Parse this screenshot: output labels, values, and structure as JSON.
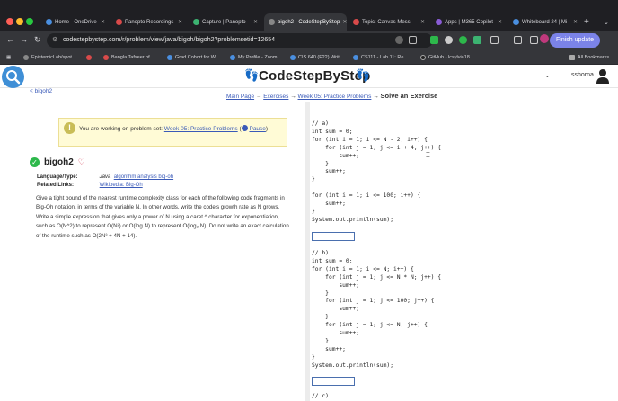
{
  "browser": {
    "tabs": [
      {
        "label": "Home - OneDrive",
        "color": "#4a8fe0"
      },
      {
        "label": "Panopto Recordings",
        "color": "#d94a4a"
      },
      {
        "label": "Capture | Panopto",
        "color": "#3cb371"
      },
      {
        "label": "bigoh2 - CodeStepByStep",
        "color": "#888888",
        "active": true
      },
      {
        "label": "Topic: Canvas Mess",
        "color": "#d94a4a"
      },
      {
        "label": "Apps | M365 Copilot",
        "color": "#8a5cd6"
      },
      {
        "label": "Whiteboard 24 | Mi",
        "color": "#4a8fe0"
      }
    ],
    "url": "codestepbystep.com/r/problem/view/java/bigoh/bigoh2?problemsetid=12654",
    "finish_update": "Finish update",
    "bookmarks": [
      {
        "label": "EpistemicLab/spot...",
        "color": "#888888"
      },
      {
        "label": "Bangla Tafseer of...",
        "color": "#d94a4a"
      },
      {
        "label": "Grad Cohort for W...",
        "color": "#4a8fe0"
      },
      {
        "label": "My Profile - Zoom",
        "color": "#4a8fe0"
      },
      {
        "label": "CIS 640 (F22) Writ...",
        "color": "#4a8fe0"
      },
      {
        "label": "CS111 - Lab 11: Re...",
        "color": "#4a8fe0"
      },
      {
        "label": "GitHub - lcsylvia18...",
        "color": "#222222"
      },
      {
        "label": "All Bookmarks",
        "color": "#aaaaaa"
      }
    ]
  },
  "site": {
    "title": "CodeStepByStep",
    "user": "sshorna",
    "back_link": "< bigoh2"
  },
  "breadcrumb": {
    "main": "Main Page",
    "exercises": "Exercises",
    "week": "Week 05: Practice Problems",
    "current": "Solve an Exercise",
    "sep": "→"
  },
  "notice": {
    "prefix": "You are working on problem set:",
    "set_link": "Week 05: Practice Problems",
    "pause": "Pause"
  },
  "problem": {
    "name": "bigoh2",
    "language_label": "Language/Type:",
    "language": "Java",
    "tags": "algorithm analysis big-oh",
    "related_label": "Related Links:",
    "related": "Wikipedia: Big-Oh",
    "description": "Give a tight bound of the nearest runtime complexity class for each of the following code fragments in Big-Oh notation, in terms of the variable N. In other words, write the code's growth rate as N grows. Write a simple expression that gives only a power of N using a caret ^ character for exponentiation, such as O(N^2) to represent O(N²) or O(log N) to represent O(log₂ N). Do not write an exact calculation of the runtime such as O(2N³ + 4N + 14)."
  },
  "code": {
    "a": "// a)\nint sum = 0;\nfor (int i = 1; i <= N - 2; i++) {\n    for (int j = 1; j <= i + 4; j++) {\n        sum++;\n    }\n    sum++;\n}\n\nfor (int i = 1; i <= 100; i++) {\n    sum++;\n}\nSystem.out.println(sum);",
    "b": "// b)\nint sum = 0;\nfor (int i = 1; i <= N; i++) {\n    for (int j = 1; j <= N * N; j++) {\n        sum++;\n    }\n    for (int j = 1; j <= 100; j++) {\n        sum++;\n    }\n    for (int j = 1; j <= N; j++) {\n        sum++;\n    }\n    sum++;\n}\nSystem.out.println(sum);",
    "c": "// c)",
    "answer_a": "",
    "answer_b": ""
  }
}
